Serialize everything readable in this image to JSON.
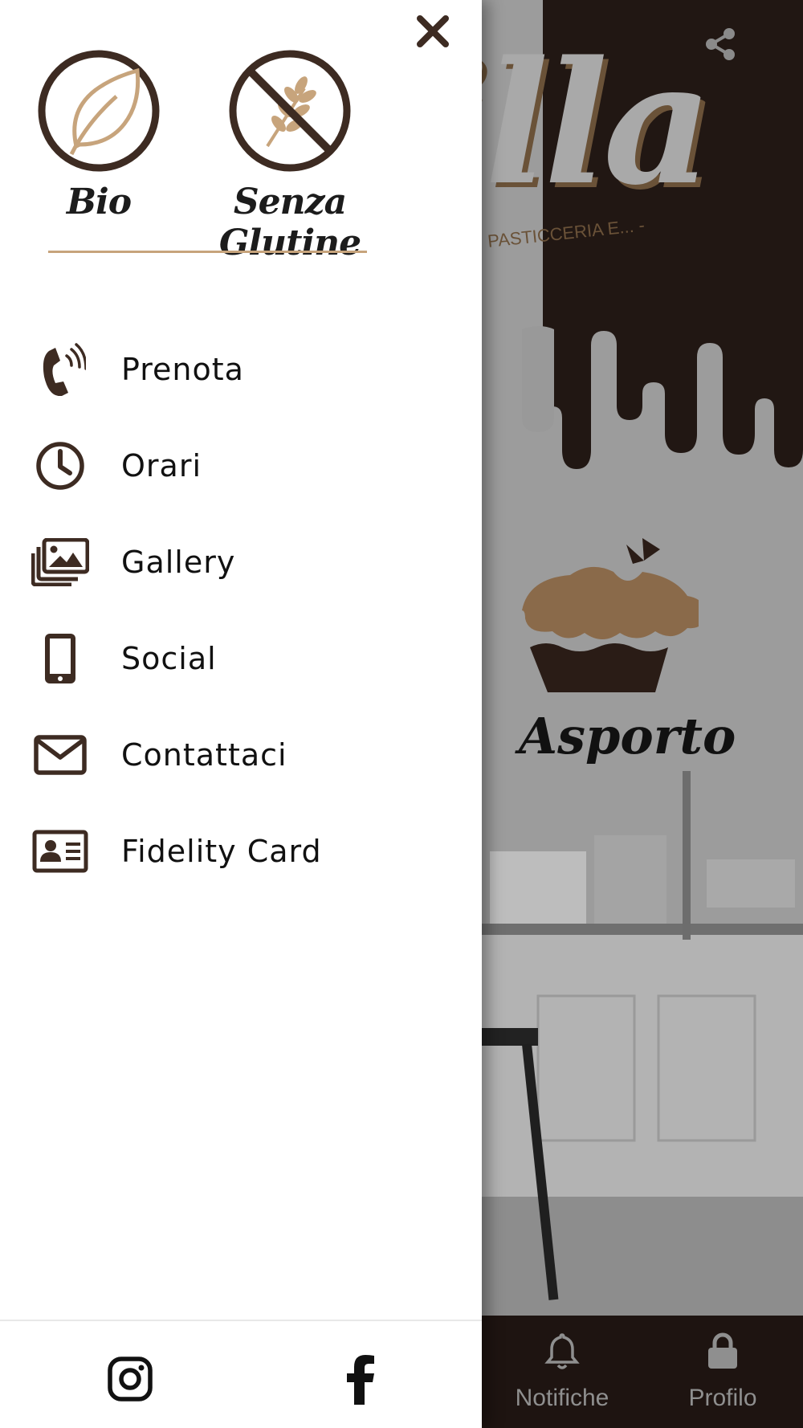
{
  "app": {
    "logo_subtitle": "PASTICCERIA E... -",
    "asporto_label": "Asporto",
    "bottom_tabs": [
      {
        "label": "Notifiche",
        "icon": "bell-icon"
      },
      {
        "label": "Profilo",
        "icon": "lock-icon"
      }
    ]
  },
  "drawer": {
    "badges": [
      {
        "label": "Bio",
        "icon": "leaf-icon"
      },
      {
        "label": "Senza Glutine",
        "icon": "no-wheat-icon"
      }
    ],
    "menu": [
      {
        "label": "Prenota",
        "icon": "phone-ringing-icon"
      },
      {
        "label": "Orari",
        "icon": "clock-icon"
      },
      {
        "label": "Gallery",
        "icon": "images-icon"
      },
      {
        "label": "Social",
        "icon": "smartphone-icon"
      },
      {
        "label": "Contattaci",
        "icon": "envelope-icon"
      },
      {
        "label": "Fidelity Card",
        "icon": "id-card-icon"
      }
    ],
    "footer_social": [
      {
        "icon": "instagram-icon"
      },
      {
        "icon": "facebook-icon"
      }
    ]
  },
  "colors": {
    "brand_dark": "#3d2b22",
    "brand_gold": "#c7a47c",
    "header_dark": "#211713"
  }
}
